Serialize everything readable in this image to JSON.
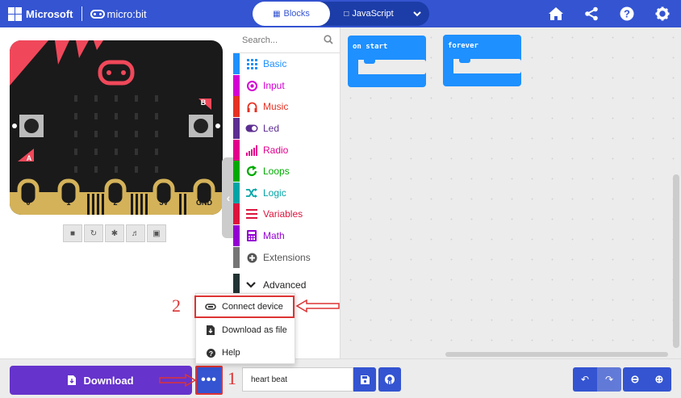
{
  "header": {
    "brand": "Microsoft",
    "product": "micro:bit",
    "modes": [
      {
        "label": "Blocks",
        "active": true
      },
      {
        "label": "JavaScript",
        "active": false
      }
    ],
    "accent": "#3454d1"
  },
  "simulator": {
    "pin_labels": [
      "0",
      "1",
      "2",
      "3V",
      "GND"
    ],
    "button_labels": [
      "A",
      "B"
    ]
  },
  "toolbox": {
    "search_placeholder": "Search...",
    "categories": [
      {
        "label": "Basic",
        "color": "#1e90ff"
      },
      {
        "label": "Input",
        "color": "#d400d4"
      },
      {
        "label": "Music",
        "color": "#e63022"
      },
      {
        "label": "Led",
        "color": "#5c2d91"
      },
      {
        "label": "Radio",
        "color": "#e3008c"
      },
      {
        "label": "Loops",
        "color": "#00aa00"
      },
      {
        "label": "Logic",
        "color": "#00a4a6"
      },
      {
        "label": "Variables",
        "color": "#dc143c"
      },
      {
        "label": "Math",
        "color": "#9400d3"
      },
      {
        "label": "Extensions",
        "color": "#757575"
      }
    ],
    "advanced_label": "Advanced"
  },
  "workspace": {
    "blocks": [
      {
        "label": "on start"
      },
      {
        "label": "forever"
      }
    ]
  },
  "menu": {
    "items": [
      {
        "label": "Connect device"
      },
      {
        "label": "Download as file"
      },
      {
        "label": "Help"
      }
    ]
  },
  "bottom": {
    "download_label": "Download",
    "more_label": "•••",
    "project_name": "heart beat"
  },
  "annotations": {
    "step_1": "1",
    "step_2": "2"
  }
}
